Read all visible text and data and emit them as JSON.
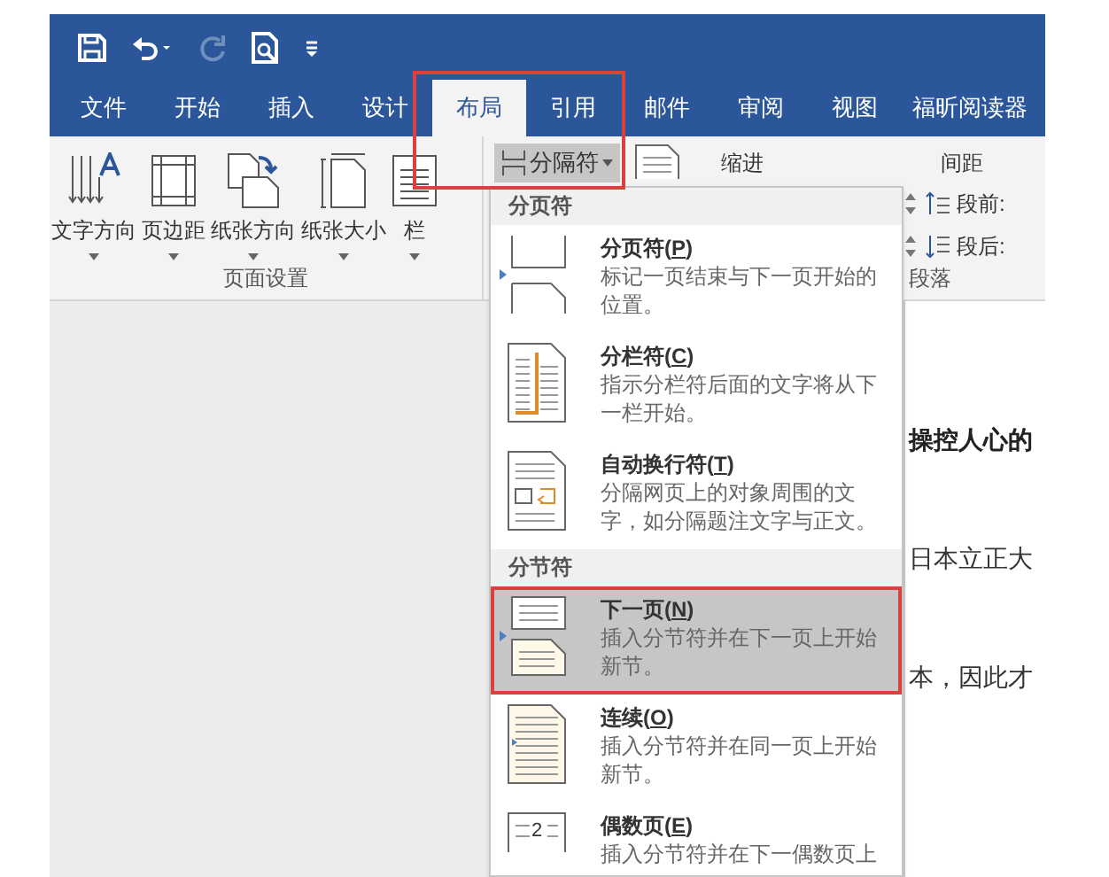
{
  "tabs": [
    {
      "label": "文件",
      "selected": false
    },
    {
      "label": "开始",
      "selected": false
    },
    {
      "label": "插入",
      "selected": false
    },
    {
      "label": "设计",
      "selected": false
    },
    {
      "label": "布局",
      "selected": true
    },
    {
      "label": "引用",
      "selected": false
    },
    {
      "label": "邮件",
      "selected": false
    },
    {
      "label": "审阅",
      "selected": false
    },
    {
      "label": "视图",
      "selected": false
    },
    {
      "label": "福昕阅读器",
      "selected": false
    }
  ],
  "page_setup": {
    "buttons": [
      {
        "label": "文字方向",
        "kind": "direction"
      },
      {
        "label": "页边距",
        "kind": "margins"
      },
      {
        "label": "纸张方向",
        "kind": "orientation"
      },
      {
        "label": "纸张大小",
        "kind": "size"
      },
      {
        "label": "栏",
        "kind": "columns"
      }
    ],
    "group_label": "页面设置"
  },
  "breaks_button": {
    "label": "分隔符",
    "expanded": true
  },
  "paragraph": {
    "indent_label": "缩进",
    "spacing_label": "间距",
    "before_label": "段前:",
    "after_label": "段后:",
    "group_label": "段落"
  },
  "breaks_menu": {
    "sections": [
      {
        "header": "分页符",
        "items": [
          {
            "kind": "page",
            "title": [
              "分页符(",
              "P",
              ")"
            ],
            "description": "标记一页结束与下一页开始的位置。",
            "selected": false
          },
          {
            "kind": "column",
            "title": [
              "分栏符(",
              "C",
              ")"
            ],
            "description": "指示分栏符后面的文字将从下一栏开始。",
            "selected": false
          },
          {
            "kind": "wrap",
            "title": [
              "自动换行符(",
              "T",
              ")"
            ],
            "description": "分隔网页上的对象周围的文字，如分隔题注文字与正文。",
            "selected": false
          }
        ]
      },
      {
        "header": "分节符",
        "items": [
          {
            "kind": "next",
            "title": [
              "下一页(",
              "N",
              ")"
            ],
            "description": "插入分节符并在下一页上开始新节。",
            "selected": true
          },
          {
            "kind": "continuous",
            "title": [
              "连续(",
              "O",
              ")"
            ],
            "description": "插入分节符并在同一页上开始新节。",
            "selected": false
          },
          {
            "kind": "even",
            "title": [
              "偶数页(",
              "E",
              ")"
            ],
            "icon_label": "2",
            "description": "插入分节符并在下一偶数页上",
            "selected": false
          }
        ]
      }
    ]
  },
  "document": {
    "lines": [
      {
        "kind": "heading",
        "text": "操控人心的"
      },
      {
        "kind": "body",
        "text": "日本立正大"
      },
      {
        "kind": "body",
        "text": "本，因此才"
      }
    ]
  }
}
